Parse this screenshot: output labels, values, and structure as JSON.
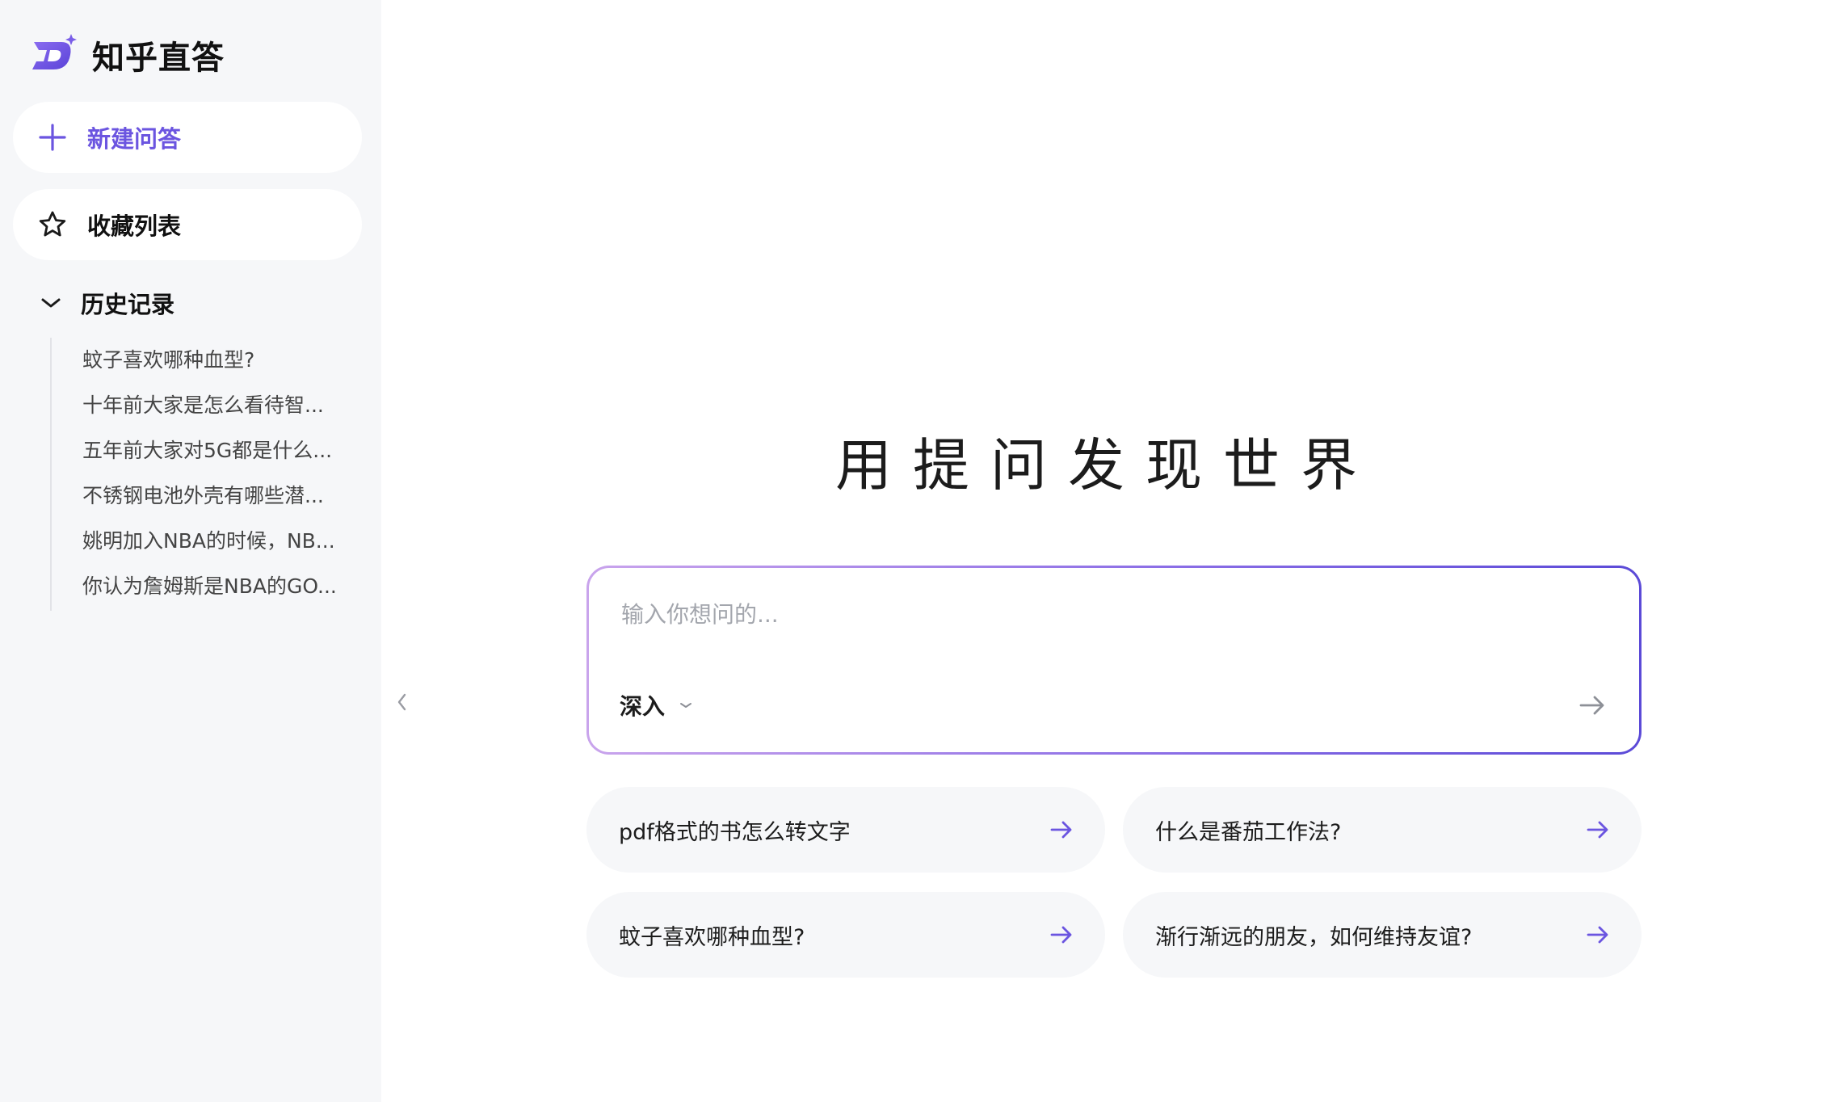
{
  "brand": {
    "name": "知乎直答",
    "logo_icon": "zhida-logo-icon",
    "accent": "#6b55e0"
  },
  "sidebar": {
    "new_qa": {
      "label": "新建问答",
      "icon": "plus-icon"
    },
    "favorites": {
      "label": "收藏列表",
      "icon": "star-icon"
    },
    "history": {
      "label": "历史记录",
      "icon": "chevron-down-icon",
      "items": [
        {
          "label": "蚊子喜欢哪种血型?"
        },
        {
          "label": "十年前大家是怎么看待智..."
        },
        {
          "label": "五年前大家对5G都是什么..."
        },
        {
          "label": "不锈钢电池外壳有哪些潜..."
        },
        {
          "label": "姚明加入NBA的时候，NB..."
        },
        {
          "label": "你认为詹姆斯是NBA的GO..."
        }
      ]
    },
    "collapse_icon": "chevron-left-icon"
  },
  "main": {
    "title": "用提问发现世界",
    "ask": {
      "placeholder": "输入你想问的...",
      "value": "",
      "mode_label": "深入",
      "mode_icon": "chevron-down-icon",
      "send_icon": "arrow-right-icon",
      "gradient": [
        "#c9a4ec",
        "#8b6ee6",
        "#5b4ad7"
      ]
    },
    "suggestions": [
      {
        "text": "pdf格式的书怎么转文字"
      },
      {
        "text": "什么是番茄工作法?"
      },
      {
        "text": "蚊子喜欢哪种血型?"
      },
      {
        "text": "渐行渐远的朋友，如何维持友谊?"
      }
    ]
  }
}
